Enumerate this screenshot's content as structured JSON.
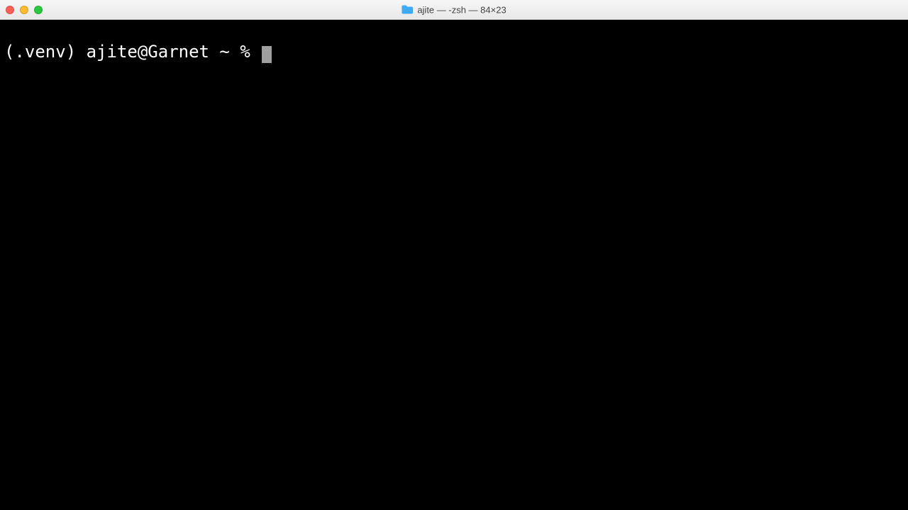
{
  "titlebar": {
    "title": "ajite — -zsh — 84×23",
    "folder_icon_color": "#3fa9f5"
  },
  "terminal": {
    "prompt": "(.venv) ajite@Garnet ~ % "
  }
}
